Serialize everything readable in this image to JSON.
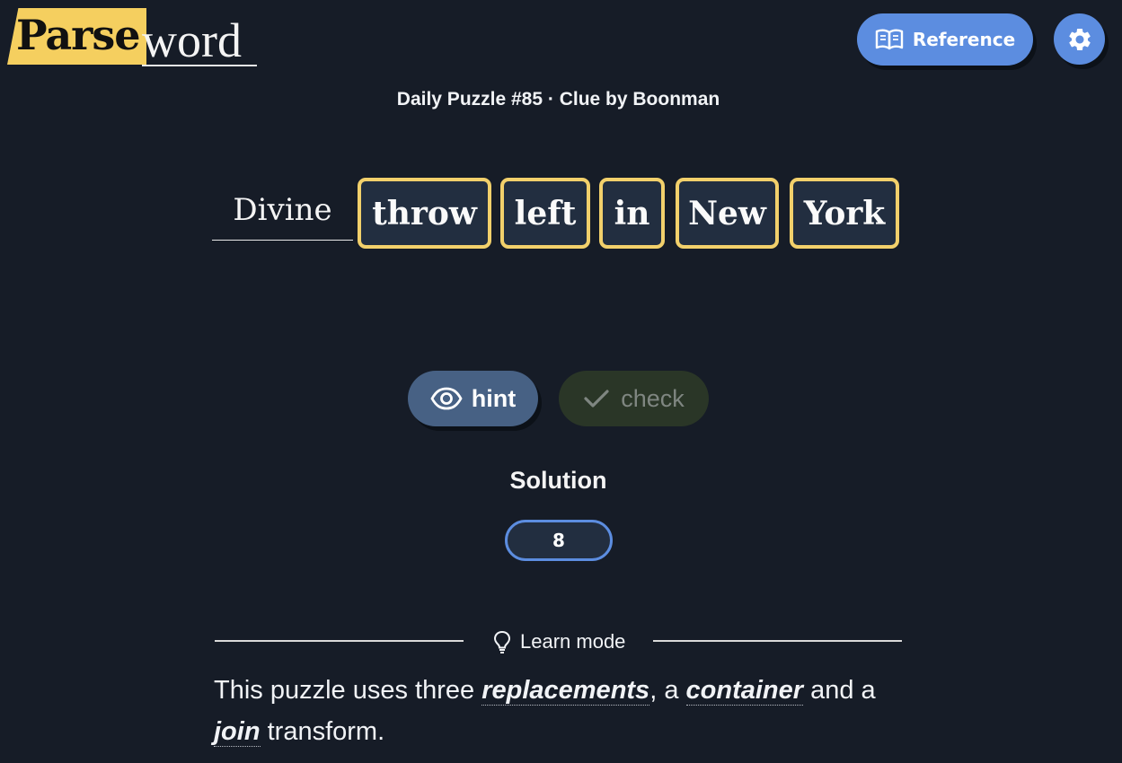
{
  "logo": {
    "highlight_text": "Parse",
    "rest_text": "word"
  },
  "header": {
    "reference_label": "Reference",
    "reference_icon": "book-open-icon",
    "settings_icon": "gear-icon"
  },
  "subtitle": "Daily Puzzle #85 · Clue by Boonman",
  "clue": {
    "definition": "Divine",
    "words": [
      "throw",
      "left",
      "in",
      "New",
      "York"
    ]
  },
  "actions": {
    "hint_label": "hint",
    "hint_icon": "eye-icon",
    "check_label": "check",
    "check_icon": "checkmark-icon"
  },
  "solution": {
    "label": "Solution",
    "length": "8"
  },
  "learn": {
    "label": "Learn mode",
    "icon": "lightbulb-icon",
    "text_1": "This puzzle uses three ",
    "term_1": "replacements",
    "text_2": ", a ",
    "term_2": "container",
    "text_3": " and a",
    "term_3": "join",
    "text_4": " transform."
  },
  "colors": {
    "background": "#161c27",
    "accent_blue": "#5c8de0",
    "highlight_yellow": "#f5cf5f",
    "word_border": "#f2d06b",
    "hint_button": "#476184",
    "check_button": "#2a3627"
  }
}
